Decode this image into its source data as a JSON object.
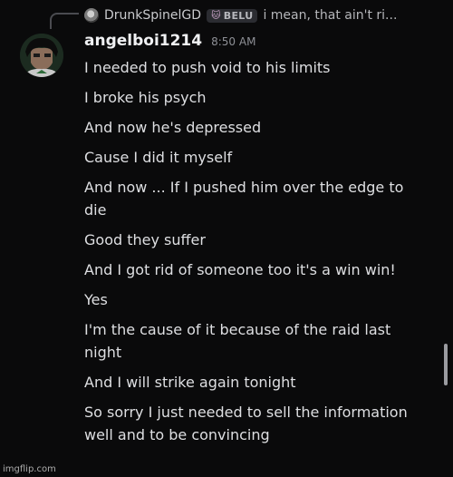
{
  "reply_preview": {
    "author": "DrunkSpinelGD",
    "tag": "BELU",
    "tag_icon": "cat-icon",
    "text": "i mean, that ain't ri..."
  },
  "message": {
    "author": "angelboi1214",
    "timestamp": "8:50 AM",
    "lines": [
      "I needed to push void to his limits",
      "I broke his psych",
      "And now he's depressed",
      "Cause I did it myself",
      "And now ... If I pushed him over the edge to die",
      "Good they suffer",
      "And I got rid of someone too it's a win win!",
      "Yes",
      "I'm the cause of it because of the raid last night",
      "And I will strike again tonight",
      "So sorry I just needed to sell the information well and to be convincing"
    ]
  },
  "watermark": "imgflip.com",
  "colors": {
    "background": "#0a0a0b",
    "text": "#dedfe2",
    "muted": "#8e9096",
    "tag_bg": "#2b2c31"
  }
}
